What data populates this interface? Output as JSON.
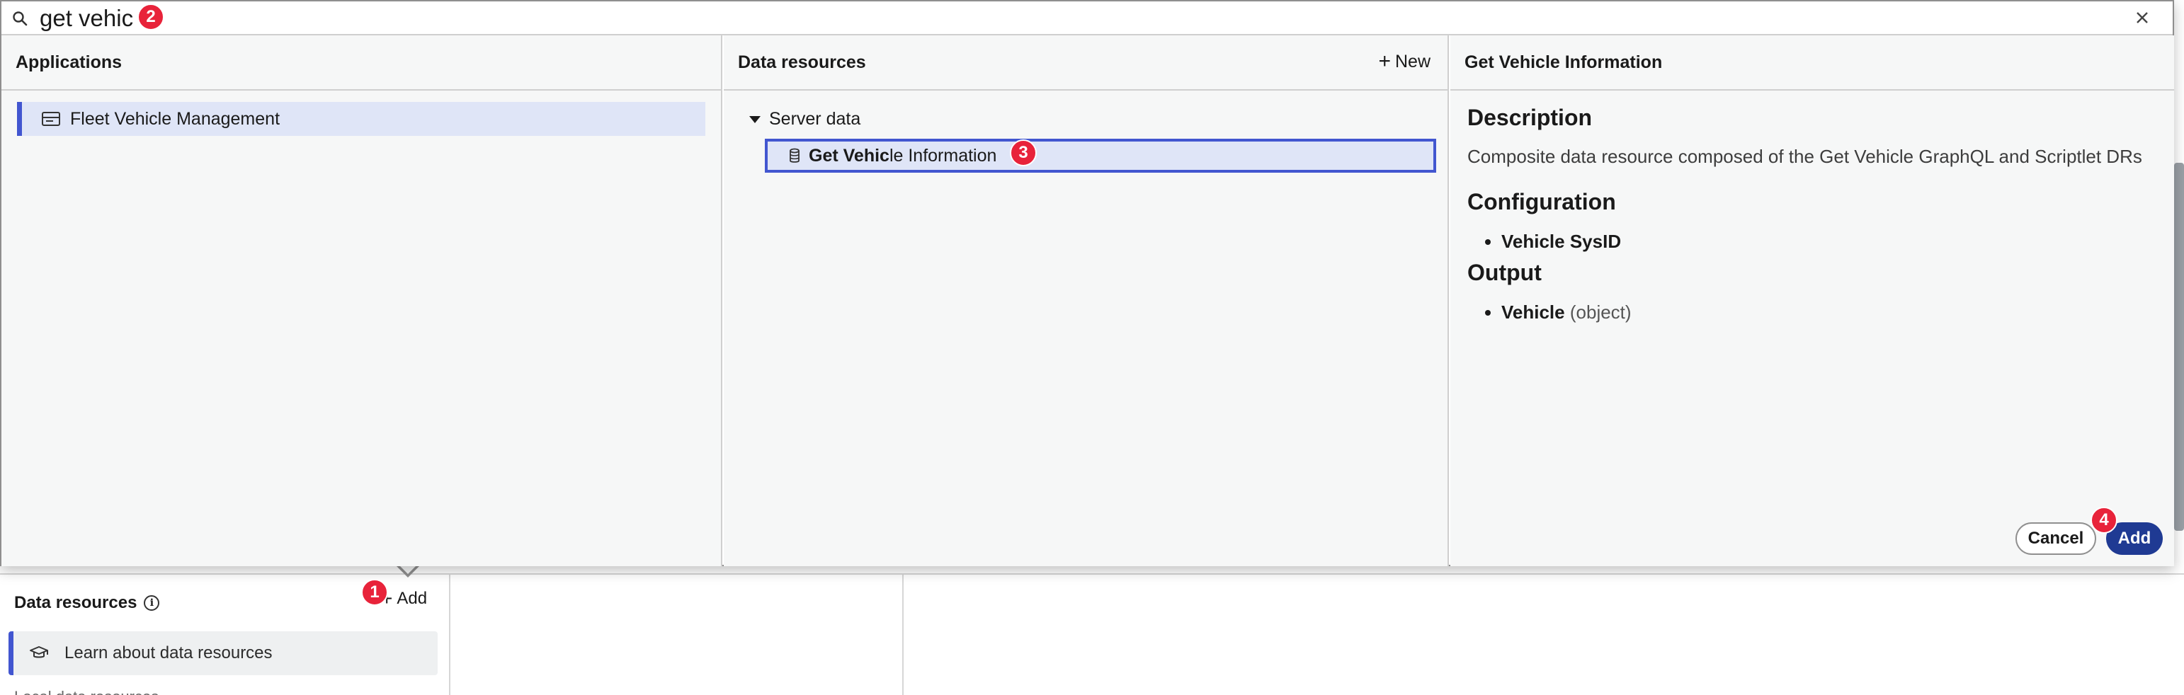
{
  "search": {
    "value": "get vehic"
  },
  "applications": {
    "header": "Applications",
    "items": [
      {
        "label": "Fleet Vehicle Management",
        "icon": "app-window-icon",
        "selected": true
      }
    ]
  },
  "data_resources_pane": {
    "header": "Data resources",
    "new_label": "New",
    "group": "Server data",
    "item": {
      "match": "Get Vehic",
      "rest": "le Information",
      "icon": "database-icon",
      "selected": true
    }
  },
  "info": {
    "header": "Get Vehicle Information",
    "description_heading": "Description",
    "description": "Composite data resource composed of the Get Vehicle GraphQL and Scriptlet DRs",
    "configuration_heading": "Configuration",
    "configuration_items": [
      "Vehicle SysID"
    ],
    "output_heading": "Output",
    "output_item": {
      "name": "Vehicle",
      "type": "(object)"
    }
  },
  "actions": {
    "cancel": "Cancel",
    "add": "Add"
  },
  "background": {
    "data_resources_title": "Data resources",
    "add_label": "Add",
    "learn_label": "Learn about data resources",
    "next_row_label": "Local data resources"
  },
  "badges": {
    "b1": "1",
    "b2": "2",
    "b3": "3",
    "b4": "4"
  },
  "colors": {
    "accent": "#4256d0",
    "primary_button": "#1f3a93",
    "badge": "#e8233a",
    "selected_bg": "#dfe5f7"
  }
}
